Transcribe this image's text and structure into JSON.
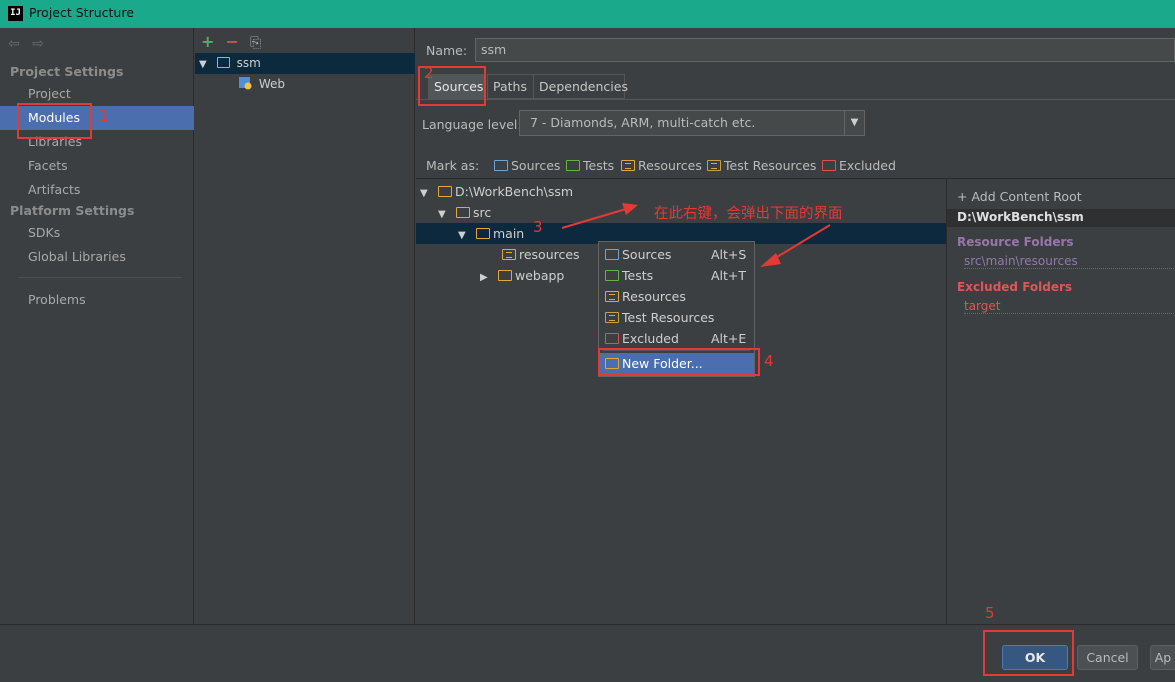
{
  "window": {
    "title": "Project Structure",
    "logo": "IJ"
  },
  "nav": {
    "arrows": [
      "⇦",
      "⇨"
    ],
    "project_settings": "Project Settings",
    "items_ps": [
      "Project",
      "Modules",
      "Libraries",
      "Facets",
      "Artifacts"
    ],
    "platform_settings": "Platform Settings",
    "items_pf": [
      "SDKs",
      "Global Libraries"
    ],
    "problems": "Problems",
    "selected": "Modules"
  },
  "modules": {
    "tools": [
      "+",
      "−",
      "⎘"
    ],
    "tree": [
      {
        "label": "ssm",
        "level": 0
      },
      {
        "label": "Web",
        "level": 1
      }
    ]
  },
  "main": {
    "name_label": "Name:",
    "name_value": "ssm",
    "tabs": [
      "Sources",
      "Paths",
      "Dependencies"
    ],
    "active_tab": "Sources",
    "language_label": "Language level:",
    "language_value": "7 - Diamonds, ARM, multi-catch etc.",
    "mark_as_label": "Mark as:",
    "mark_as": [
      "Sources",
      "Tests",
      "Resources",
      "Test Resources",
      "Excluded"
    ],
    "tree": [
      {
        "label": "D:\\WorkBench\\ssm",
        "level": 0,
        "expanded": true
      },
      {
        "label": "src",
        "level": 1,
        "expanded": true
      },
      {
        "label": "main",
        "level": 2,
        "expanded": true,
        "selected": true
      },
      {
        "label": "resources",
        "level": 3
      },
      {
        "label": "webapp",
        "level": 3,
        "expanded": false
      }
    ]
  },
  "content_root": {
    "add_label": "+ Add Content Root",
    "path": "D:\\WorkBench\\ssm",
    "resource_folders_title": "Resource Folders",
    "resource_folders": [
      "src\\main\\resources"
    ],
    "excluded_folders_title": "Excluded Folders",
    "excluded_folders": [
      "target"
    ]
  },
  "context_menu": {
    "items": [
      {
        "label": "Sources",
        "shortcut": "Alt+S"
      },
      {
        "label": "Tests",
        "shortcut": "Alt+T"
      },
      {
        "label": "Resources",
        "shortcut": ""
      },
      {
        "label": "Test Resources",
        "shortcut": ""
      },
      {
        "label": "Excluded",
        "shortcut": "Alt+E"
      },
      {
        "label": "New Folder...",
        "shortcut": ""
      }
    ]
  },
  "footer": {
    "ok": "OK",
    "cancel": "Cancel",
    "apply": "Ap"
  },
  "annotations": {
    "numbers": [
      "1",
      "2",
      "3",
      "4",
      "5"
    ],
    "note": "在此右键，会弹出下面的界面",
    "color": "#e53935"
  },
  "colors": {
    "title_bar": "#1aa98b",
    "selection": "#4b6eaf",
    "tree_selection": "#0d293e"
  }
}
